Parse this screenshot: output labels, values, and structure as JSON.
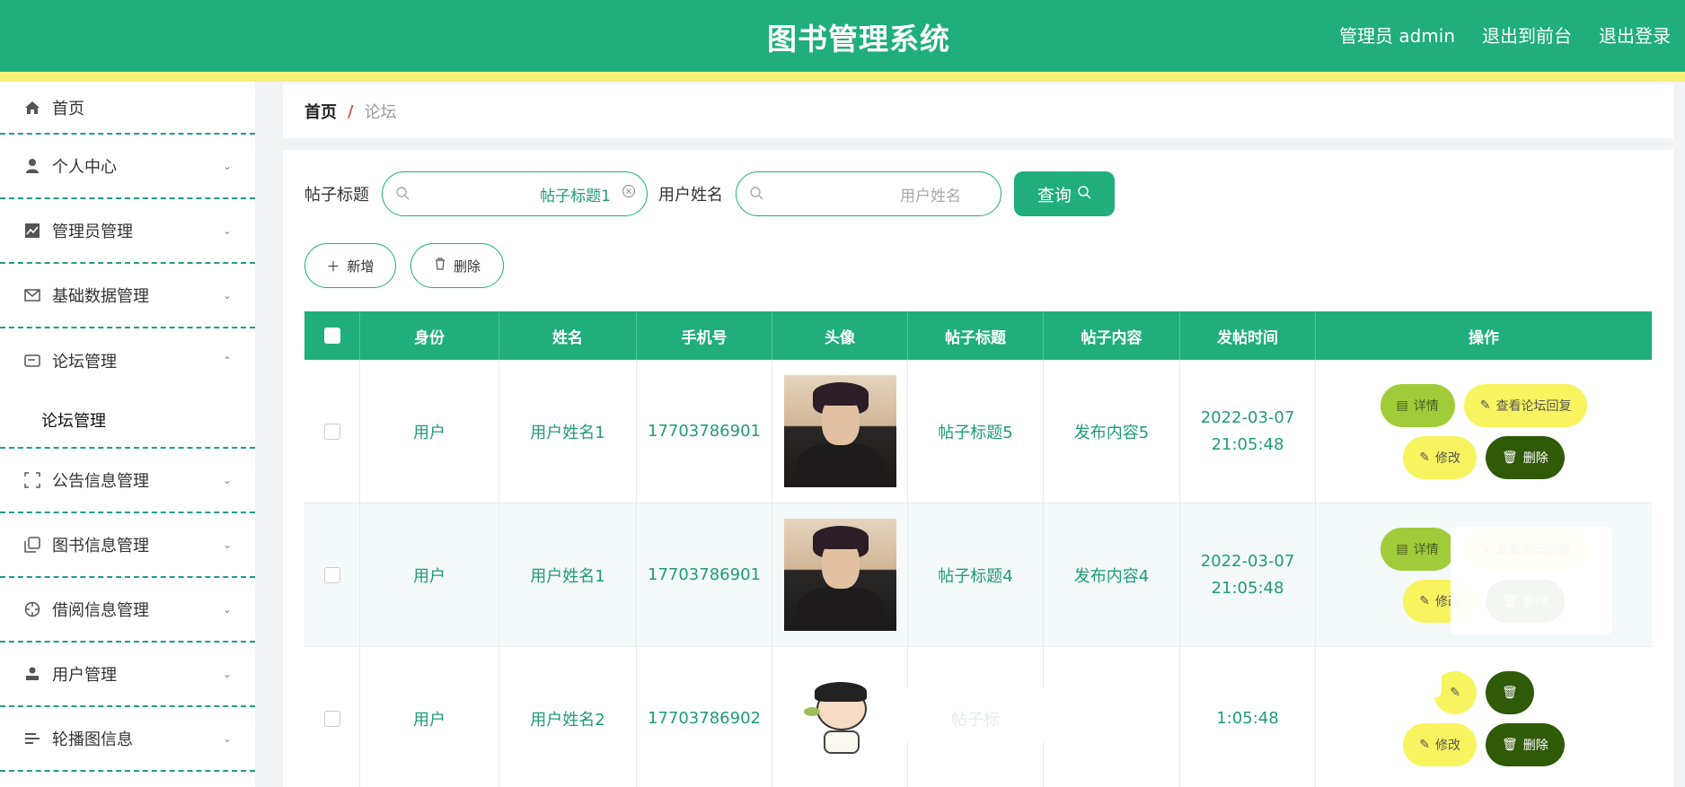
{
  "header": {
    "title": "图书管理系统",
    "admin": "管理员 admin",
    "front": "退出到前台",
    "logout": "退出登录"
  },
  "colors": {
    "primary": "#1fae7c",
    "stripe": "#f4f07a",
    "yellow": "#f8f45f",
    "lime": "#a0cc3a",
    "dark": "#2f5a08"
  },
  "sidebar": {
    "items": [
      {
        "label": "首页",
        "icon": "home-icon"
      },
      {
        "label": "个人中心",
        "icon": "user-icon"
      },
      {
        "label": "管理员管理",
        "icon": "chart-icon"
      },
      {
        "label": "基础数据管理",
        "icon": "mail-icon"
      },
      {
        "label": "论坛管理",
        "icon": "card-icon"
      },
      {
        "label": "公告信息管理",
        "icon": "frame-icon"
      },
      {
        "label": "图书信息管理",
        "icon": "copy-icon"
      },
      {
        "label": "借阅信息管理",
        "icon": "crosshair-icon"
      },
      {
        "label": "用户管理",
        "icon": "person-icon"
      },
      {
        "label": "轮播图信息",
        "icon": "list-icon"
      }
    ],
    "sub_item": "论坛管理"
  },
  "breadcrumb": {
    "home": "首页",
    "sep": "/",
    "current": "论坛"
  },
  "search": {
    "title_label": "帖子标题",
    "title_value": "帖子标题1",
    "name_label": "用户姓名",
    "name_placeholder": "用户姓名",
    "query": "查询"
  },
  "actions": {
    "add": "新增",
    "delete": "删除"
  },
  "table": {
    "headers": [
      "身份",
      "姓名",
      "手机号",
      "头像",
      "帖子标题",
      "帖子内容",
      "发帖时间",
      "操作"
    ],
    "rows": [
      {
        "role": "用户",
        "name": "用户姓名1",
        "phone": "17703786901",
        "avatar": "photo",
        "title": "帖子标题5",
        "content": "发布内容5",
        "time": "2022-03-07 21:05:48"
      },
      {
        "role": "用户",
        "name": "用户姓名1",
        "phone": "17703786901",
        "avatar": "photo",
        "title": "帖子标题4",
        "content": "发布内容4",
        "time": "2022-03-07 21:05:48"
      },
      {
        "role": "用户",
        "name": "用户姓名2",
        "phone": "17703786902",
        "avatar": "cartoon",
        "title": "帖子标",
        "content": "",
        "time": "1:05:48"
      }
    ],
    "ops": {
      "detail": "详情",
      "reply": "查看论坛回复",
      "edit": "修改",
      "delete": "删除"
    }
  }
}
